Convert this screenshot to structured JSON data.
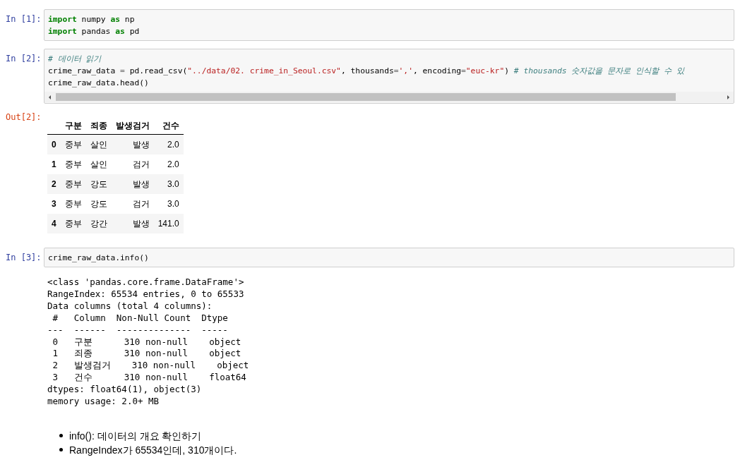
{
  "cells": [
    {
      "kind": "code",
      "prompt": "In [1]:",
      "scrollbar": false,
      "lines": [
        [
          {
            "t": "import",
            "kind": "keyword"
          },
          {
            "t": " numpy ",
            "kind": "plain"
          },
          {
            "t": "as",
            "kind": "keyword"
          },
          {
            "t": " np",
            "kind": "plain"
          }
        ],
        [
          {
            "t": "import",
            "kind": "keyword"
          },
          {
            "t": " pandas ",
            "kind": "plain"
          },
          {
            "t": "as",
            "kind": "keyword"
          },
          {
            "t": " pd",
            "kind": "plain"
          }
        ]
      ]
    },
    {
      "kind": "code",
      "prompt": "In [2]:",
      "scrollbar": true,
      "lines": [
        [
          {
            "t": "# 데이터 읽기",
            "kind": "comment"
          }
        ],
        [
          {
            "t": "crime_raw_data ",
            "kind": "plain"
          },
          {
            "t": "=",
            "kind": "op"
          },
          {
            "t": " pd.read_csv(",
            "kind": "plain"
          },
          {
            "t": "\"../data/02. crime_in_Seoul.csv\"",
            "kind": "string"
          },
          {
            "t": ", thousands",
            "kind": "plain"
          },
          {
            "t": "=",
            "kind": "op"
          },
          {
            "t": "','",
            "kind": "string"
          },
          {
            "t": ", encoding",
            "kind": "plain"
          },
          {
            "t": "=",
            "kind": "op"
          },
          {
            "t": "\"euc-kr\"",
            "kind": "string"
          },
          {
            "t": ") ",
            "kind": "plain"
          },
          {
            "t": "# thousands 숫자값을 문자로 인식할 수 있",
            "kind": "comment"
          }
        ],
        [
          {
            "t": "crime_raw_data.head()",
            "kind": "plain"
          }
        ]
      ]
    },
    {
      "kind": "table",
      "prompt": "Out[2]:",
      "columns": [
        "구분",
        "죄종",
        "발생검거",
        "건수"
      ],
      "rows": [
        {
          "index": "0",
          "cells": [
            "중부",
            "살인",
            "발생",
            "2.0"
          ]
        },
        {
          "index": "1",
          "cells": [
            "중부",
            "살인",
            "검거",
            "2.0"
          ]
        },
        {
          "index": "2",
          "cells": [
            "중부",
            "강도",
            "발생",
            "3.0"
          ]
        },
        {
          "index": "3",
          "cells": [
            "중부",
            "강도",
            "검거",
            "3.0"
          ]
        },
        {
          "index": "4",
          "cells": [
            "중부",
            "강간",
            "발생",
            "141.0"
          ]
        }
      ]
    },
    {
      "kind": "code",
      "prompt": "In [3]:",
      "scrollbar": false,
      "lines": [
        [
          {
            "t": "crime_raw_data.info()",
            "kind": "plain"
          }
        ]
      ]
    },
    {
      "kind": "stream",
      "lines": [
        "<class 'pandas.core.frame.DataFrame'>",
        "RangeIndex: 65534 entries, 0 to 65533",
        "Data columns (total 4 columns):",
        " #   Column  Non-Null Count  Dtype ",
        "---  ------  --------------  ----- ",
        " 0   구분      310 non-null    object",
        " 1   죄종      310 non-null    object",
        " 2   발생검거    310 non-null    object",
        " 3   건수      310 non-null    float64",
        "dtypes: float64(1), object(3)",
        "memory usage: 2.0+ MB"
      ]
    },
    {
      "kind": "markdown",
      "bullets": [
        "info(): 데이터의 개요 확인하기",
        "RangeIndex가 65534인데, 310개이다."
      ]
    }
  ]
}
